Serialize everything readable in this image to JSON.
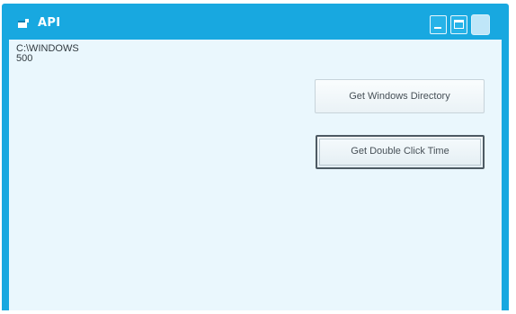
{
  "window": {
    "title": "API"
  },
  "icons": {
    "app": "app-icon",
    "minimize": "minimize-icon",
    "maximize": "maximize-icon"
  },
  "colors": {
    "titlebar": "#18a8e0",
    "client": "#eaf7fd",
    "title_text": "#ffffff",
    "text": "#30393f"
  },
  "output": {
    "lines": [
      "C:\\WINDOWS",
      "500"
    ]
  },
  "buttons": {
    "get_windows_directory": "Get Windows Directory",
    "get_double_click_time": "Get Double Click Time"
  }
}
